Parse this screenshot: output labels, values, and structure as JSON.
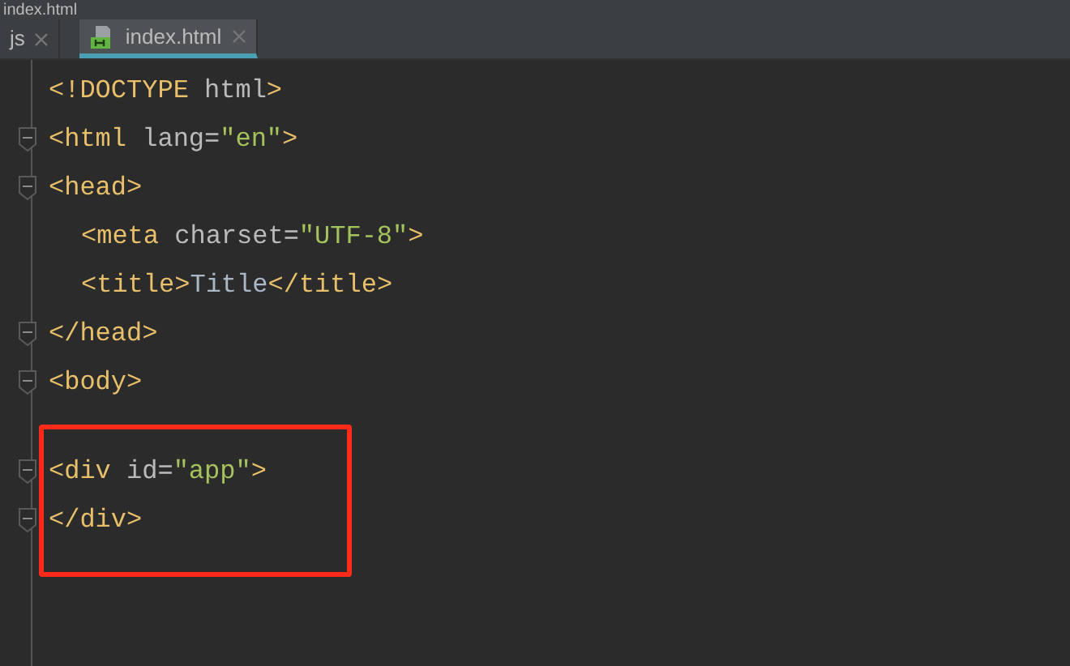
{
  "window": {
    "title": "index.html"
  },
  "tabs": [
    {
      "label": "js",
      "icon": false,
      "selected": false
    },
    {
      "label": "index.html",
      "icon": true,
      "selected": true
    }
  ],
  "editor": {
    "lines": [
      {
        "tokens": [
          {
            "kind": "tag",
            "text": "<!DOCTYPE "
          },
          {
            "kind": "attr",
            "text": "html"
          },
          {
            "kind": "tag",
            "text": ">"
          }
        ]
      },
      {
        "fold": true,
        "tokens": [
          {
            "kind": "tag",
            "text": "<html "
          },
          {
            "kind": "attr",
            "text": "lang="
          },
          {
            "kind": "string",
            "text": "\"en\""
          },
          {
            "kind": "tag",
            "text": ">"
          }
        ]
      },
      {
        "fold": true,
        "tokens": [
          {
            "kind": "tag",
            "text": "<head>"
          }
        ]
      },
      {
        "indent": true,
        "tokens": [
          {
            "kind": "tag",
            "text": "<meta "
          },
          {
            "kind": "attr",
            "text": "charset="
          },
          {
            "kind": "string",
            "text": "\"UTF-8\""
          },
          {
            "kind": "tag",
            "text": ">"
          }
        ]
      },
      {
        "indent": true,
        "tokens": [
          {
            "kind": "tag",
            "text": "<title>"
          },
          {
            "kind": "text",
            "text": "Title"
          },
          {
            "kind": "tag",
            "text": "</title>"
          }
        ]
      },
      {
        "fold": true,
        "tokens": [
          {
            "kind": "tag",
            "text": "</head>"
          }
        ]
      },
      {
        "fold": true,
        "tokens": [
          {
            "kind": "tag",
            "text": "<body>"
          }
        ]
      }
    ],
    "highlight_box": {
      "lines": [
        {
          "fold": true,
          "tokens": [
            {
              "kind": "tag",
              "text": "<div "
            },
            {
              "kind": "attr",
              "text": "id="
            },
            {
              "kind": "string",
              "text": "\"app\""
            },
            {
              "kind": "tag",
              "text": ">"
            }
          ]
        },
        {
          "fold": true,
          "tokens": [
            {
              "kind": "tag",
              "text": "</div>"
            }
          ]
        }
      ]
    }
  }
}
